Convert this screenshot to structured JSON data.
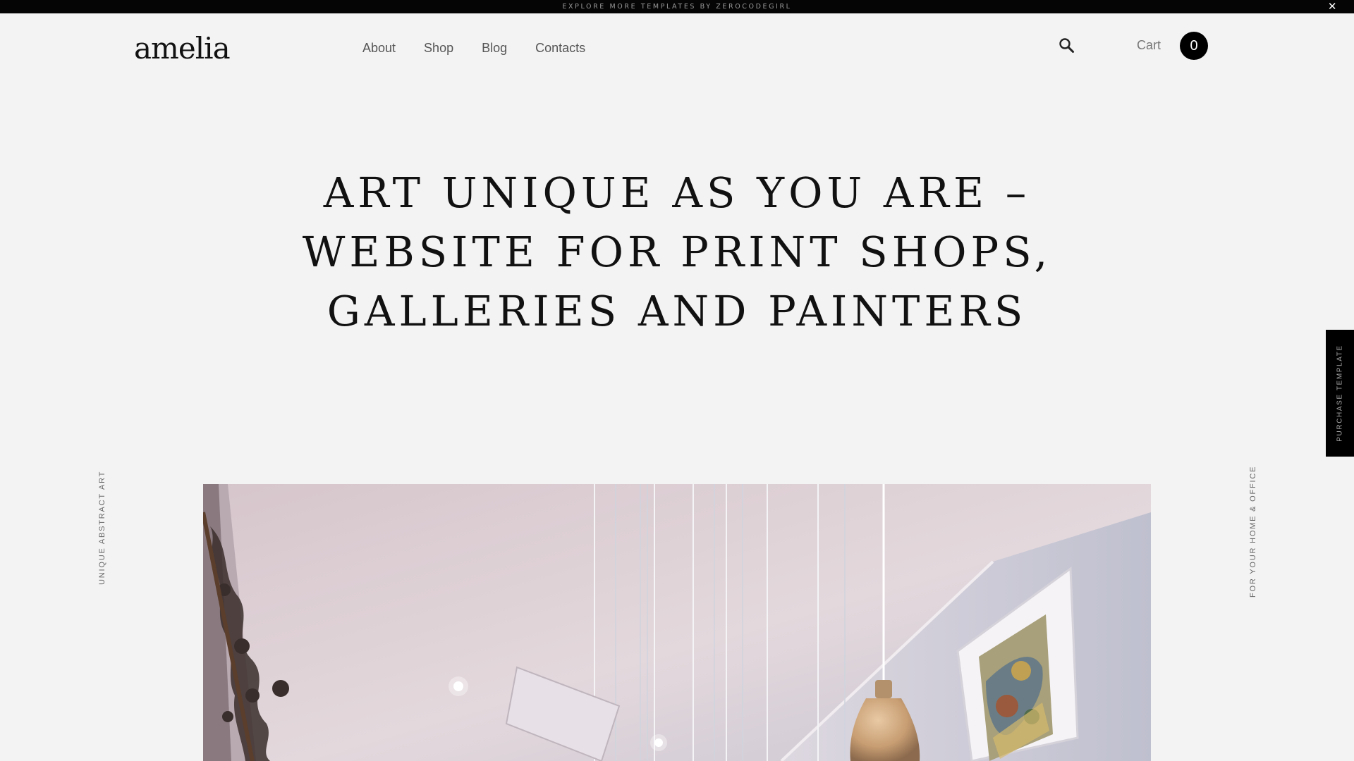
{
  "announcement": {
    "text": "EXPLORE MORE TEMPLATES BY ZEROCODEGIRL",
    "close_icon": "close-icon"
  },
  "header": {
    "logo": "amelia",
    "nav": [
      "About",
      "Shop",
      "Blog",
      "Contacts"
    ],
    "search_icon": "search-icon",
    "cart_label": "Cart",
    "cart_count": "0"
  },
  "hero": {
    "title_lines": [
      "ART UNIQUE AS YOU ARE –",
      "WEBSITE FOR PRINT SHOPS,",
      "GALLERIES AND PAINTERS"
    ]
  },
  "side": {
    "purchase": "PURCHASE TEMPLATE",
    "left_label": "UNIQUE ABSTRACT ART",
    "right_label": "FOR YOUR HOME & OFFICE"
  },
  "colors": {
    "background": "#f3f3f3",
    "topbar": "#050505",
    "accent": "#000000"
  }
}
